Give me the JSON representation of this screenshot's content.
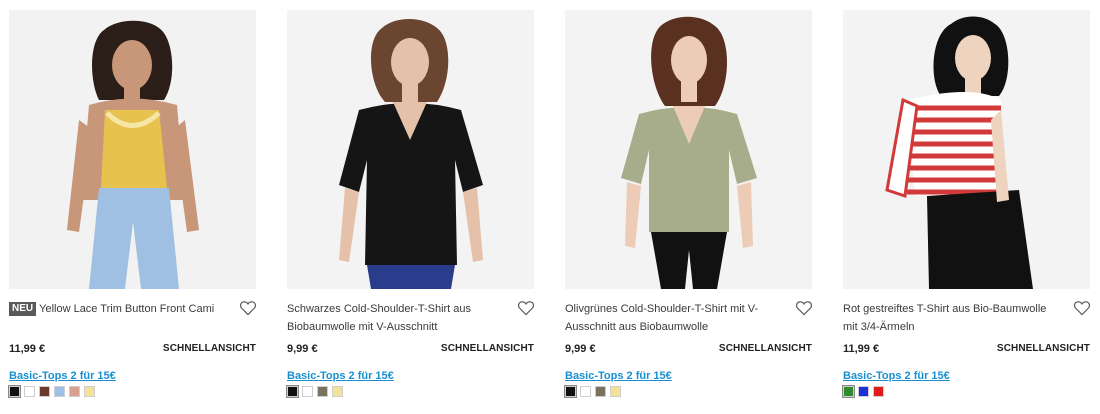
{
  "products": [
    {
      "badge": "NEU",
      "title": "Yellow Lace Trim Button Front Cami",
      "price": "11,99 €",
      "quick_view": "SCHNELLANSICHT",
      "promo": "Basic-Tops 2 für 15€",
      "swatches": [
        "#111111",
        "#ffffff",
        "#6b3a2b",
        "#9ec0e6",
        "#d9a091",
        "#f3e39a"
      ]
    },
    {
      "badge": "",
      "title": "Schwarzes Cold-Shoulder-T-Shirt aus Biobaumwolle mit V-Ausschnitt",
      "price": "9,99 €",
      "quick_view": "SCHNELLANSICHT",
      "promo": "Basic-Tops 2 für 15€",
      "swatches": [
        "#111111",
        "#ffffff",
        "#7a725e",
        "#f3e39a"
      ]
    },
    {
      "badge": "",
      "title": "Olivgrünes Cold-Shoulder-T-Shirt mit V-Ausschnitt aus Biobaumwolle",
      "price": "9,99 €",
      "quick_view": "SCHNELLANSICHT",
      "promo": "Basic-Tops 2 für 15€",
      "swatches": [
        "#111111",
        "#ffffff",
        "#7a725e",
        "#f3e39a"
      ]
    },
    {
      "badge": "",
      "title": "Rot gestreiftes T-Shirt aus Bio-Baumwolle mit 3/4-Ärmeln",
      "price": "11,99 €",
      "quick_view": "SCHNELLANSICHT",
      "promo": "Basic-Tops 2 für 15€",
      "swatches": [
        "#2e8b2e",
        "#1a2fd6",
        "#e01b1b"
      ]
    }
  ]
}
